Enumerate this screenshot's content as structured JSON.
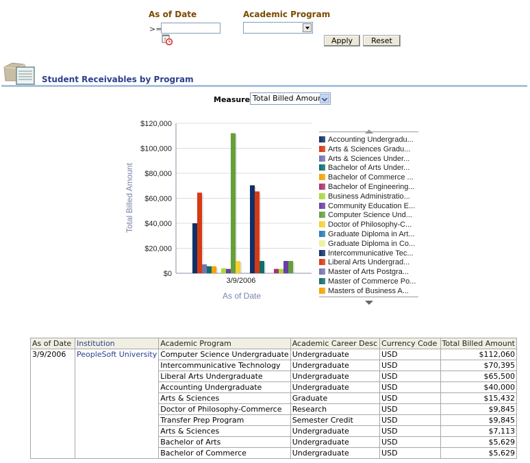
{
  "prompts": {
    "as_of_date_label": "As of Date",
    "operator": ">=",
    "as_of_date_value": "",
    "academic_program_label": "Academic Program",
    "academic_program_value": "",
    "apply_label": "Apply",
    "reset_label": "Reset"
  },
  "section": {
    "title": "Student Receivables by Program",
    "icon": "document-folder-icon"
  },
  "measure": {
    "label": "Measure",
    "selected": "Total Billed Amount"
  },
  "chart_data": {
    "type": "bar",
    "title": "",
    "xlabel": "As of Date",
    "ylabel": "Total Billed Amount",
    "categories": [
      "3/9/2006"
    ],
    "ylim": [
      0,
      120000
    ],
    "yticks": [
      "$0",
      "$20,000",
      "$40,000",
      "$60,000",
      "$80,000",
      "$100,000",
      "$120,000"
    ],
    "grid": true,
    "legend_position": "right",
    "groups": [
      {
        "bars": [
          {
            "series": "Accounting Undergraduate",
            "value": 40000
          },
          {
            "series": "Arts & Sciences Graduate",
            "value": 64500
          },
          {
            "series": "Arts & Sciences Undergraduate",
            "value": 7113
          },
          {
            "series": "Bachelor of Arts Undergraduate",
            "value": 5629
          },
          {
            "series": "Bachelor of Commerce",
            "value": 5629
          }
        ]
      },
      {
        "bars": [
          {
            "series": "Business Administration",
            "value": 4000
          },
          {
            "series": "Community Education",
            "value": 3500
          },
          {
            "series": "Computer Science Undergraduate",
            "value": 112060
          },
          {
            "series": "Doctor of Philosophy-Commerce",
            "value": 9845
          }
        ]
      },
      {
        "bars": [
          {
            "series": "Intercommunicative Technology",
            "value": 70395
          },
          {
            "series": "Liberal Arts Undergraduate",
            "value": 65500
          },
          {
            "series": "Master of Commerce Postgraduate",
            "value": 9845
          }
        ]
      },
      {
        "bars": [
          {
            "series": "Bachelor of Engineering",
            "value": 3500
          },
          {
            "series": "Business Administration",
            "value": 3500
          },
          {
            "series": "Community Education",
            "value": 9845
          },
          {
            "series": "Computer Science Undergraduate",
            "value": 9845
          }
        ]
      }
    ],
    "legend": [
      {
        "label": "Accounting Undergradu...",
        "color": "#0f3068"
      },
      {
        "label": "Arts & Sciences Gradu...",
        "color": "#d63a12"
      },
      {
        "label": "Arts & Sciences Under...",
        "color": "#7474b0"
      },
      {
        "label": "Bachelor of Arts Under...",
        "color": "#0e6e6a"
      },
      {
        "label": "Bachelor of Commerce ...",
        "color": "#f5a300"
      },
      {
        "label": "Bachelor of Engineering...",
        "color": "#a83270"
      },
      {
        "label": "Business Administratio...",
        "color": "#a8d83a"
      },
      {
        "label": "Community Education E...",
        "color": "#6a3ea6"
      },
      {
        "label": "Computer Science Und...",
        "color": "#64a03a"
      },
      {
        "label": "Doctor of Philosophy-C...",
        "color": "#f5d030"
      },
      {
        "label": "Graduate Diploma in Art...",
        "color": "#2a7ab0"
      },
      {
        "label": "Graduate Diploma in Co...",
        "color": "#eeee9a"
      },
      {
        "label": "Intercommunicative Tec...",
        "color": "#0f3068"
      },
      {
        "label": "Liberal Arts Undergrad...",
        "color": "#d63a12"
      },
      {
        "label": "Master of Arts Postgra...",
        "color": "#7474b0"
      },
      {
        "label": "Master of Commerce Po...",
        "color": "#0e6e6a"
      },
      {
        "label": "Masters of Business A...",
        "color": "#f5a300"
      }
    ],
    "series_colors": {
      "Accounting Undergraduate": "#0f3068",
      "Arts & Sciences Graduate": "#d63a12",
      "Arts & Sciences Undergraduate": "#7474b0",
      "Bachelor of Arts Undergraduate": "#0e6e6a",
      "Bachelor of Commerce": "#f5a300",
      "Bachelor of Engineering": "#a83270",
      "Business Administration": "#a8d83a",
      "Community Education": "#6a3ea6",
      "Computer Science Undergraduate": "#64a03a",
      "Doctor of Philosophy-Commerce": "#f5d030",
      "Intercommunicative Technology": "#0f3068",
      "Liberal Arts Undergraduate": "#d63a12",
      "Master of Commerce Postgraduate": "#0e6e6a"
    }
  },
  "table": {
    "headers": [
      "As of Date",
      "Institution",
      "Academic Program",
      "Academic Career Desc",
      "Currency Code",
      "Total Billed Amount"
    ],
    "as_of_date": "3/9/2006",
    "institution": "PeopleSoft University",
    "rows": [
      {
        "program": "Computer Science Undergraduate",
        "career": "Undergraduate",
        "currency": "USD",
        "amount": "$112,060"
      },
      {
        "program": "Intercommunicative Technology",
        "career": "Undergraduate",
        "currency": "USD",
        "amount": "$70,395"
      },
      {
        "program": "Liberal Arts Undergraduate",
        "career": "Undergraduate",
        "currency": "USD",
        "amount": "$65,500"
      },
      {
        "program": "Accounting Undergraduate",
        "career": "Undergraduate",
        "currency": "USD",
        "amount": "$40,000"
      },
      {
        "program": "Arts & Sciences",
        "career": "Graduate",
        "currency": "USD",
        "amount": "$15,432"
      },
      {
        "program": "Doctor of Philosophy-Commerce",
        "career": "Research",
        "currency": "USD",
        "amount": "$9,845"
      },
      {
        "program": "Transfer Prep Program",
        "career": "Semester Credit",
        "currency": "USD",
        "amount": "$9,845"
      },
      {
        "program": "Arts & Sciences",
        "career": "Undergraduate",
        "currency": "USD",
        "amount": "$7,113"
      },
      {
        "program": "Bachelor of Arts",
        "career": "Undergraduate",
        "currency": "USD",
        "amount": "$5,629"
      },
      {
        "program": "Bachelor of Commerce",
        "career": "Undergraduate",
        "currency": "USD",
        "amount": "$5,629"
      }
    ]
  }
}
